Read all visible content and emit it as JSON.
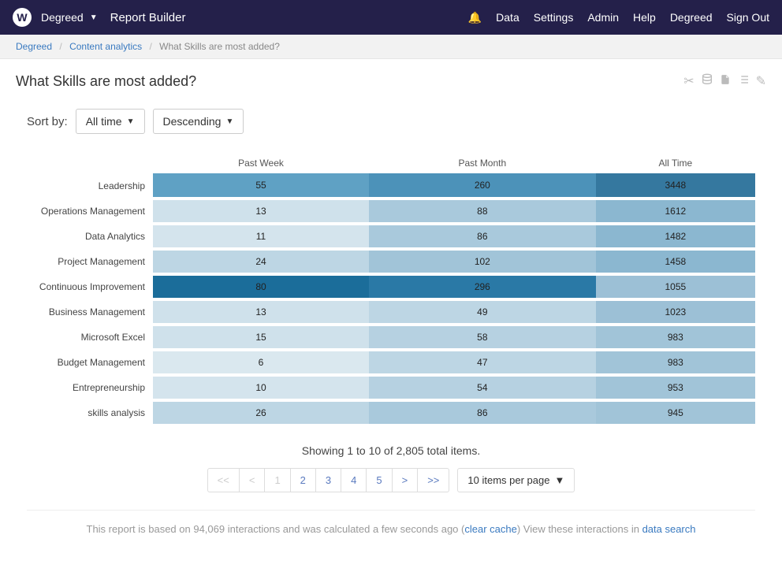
{
  "topbar": {
    "logo_letter": "W",
    "brand": "Degreed",
    "title": "Report Builder",
    "nav": {
      "data": "Data",
      "settings": "Settings",
      "admin": "Admin",
      "help": "Help",
      "degreed": "Degreed",
      "signout": "Sign Out"
    }
  },
  "breadcrumb": {
    "item1": "Degreed",
    "item2": "Content analytics",
    "item3": "What Skills are most added?"
  },
  "page_title": "What Skills are most added?",
  "sort": {
    "label": "Sort by:",
    "field": "All time",
    "direction": "Descending"
  },
  "chart_data": {
    "type": "heatmap",
    "columns": [
      "Past Week",
      "Past Month",
      "All Time"
    ],
    "rows": [
      {
        "label": "Leadership",
        "values": [
          55,
          260,
          3448
        ],
        "shades": [
          "#5fa1c4",
          "#4c92b9",
          "#35789f"
        ]
      },
      {
        "label": "Operations Management",
        "values": [
          13,
          88,
          1612
        ],
        "shades": [
          "#cfe1eb",
          "#a9c9dc",
          "#8bb7d0"
        ]
      },
      {
        "label": "Data Analytics",
        "values": [
          11,
          86,
          1482
        ],
        "shades": [
          "#d4e4ed",
          "#a9c9dc",
          "#8bb7d0"
        ]
      },
      {
        "label": "Project Management",
        "values": [
          24,
          102,
          1458
        ],
        "shades": [
          "#bdd6e4",
          "#a1c4d8",
          "#8bb7d0"
        ]
      },
      {
        "label": "Continuous Improvement",
        "values": [
          80,
          296,
          1055
        ],
        "shades": [
          "#1b6d9a",
          "#2a79a6",
          "#9cc0d6"
        ]
      },
      {
        "label": "Business Management",
        "values": [
          13,
          49,
          1023
        ],
        "shades": [
          "#cfe1eb",
          "#bdd6e4",
          "#9cc0d6"
        ]
      },
      {
        "label": "Microsoft Excel",
        "values": [
          15,
          58,
          983
        ],
        "shades": [
          "#cfe1eb",
          "#b6d1e1",
          "#a1c4d8"
        ]
      },
      {
        "label": "Budget Management",
        "values": [
          6,
          47,
          983
        ],
        "shades": [
          "#dae8ef",
          "#bdd6e4",
          "#a1c4d8"
        ]
      },
      {
        "label": "Entrepreneurship",
        "values": [
          10,
          54,
          953
        ],
        "shades": [
          "#d4e4ed",
          "#b6d1e1",
          "#a1c4d8"
        ]
      },
      {
        "label": "skills analysis",
        "values": [
          26,
          86,
          945
        ],
        "shades": [
          "#bdd6e4",
          "#a9c9dc",
          "#a1c4d8"
        ]
      }
    ]
  },
  "pagination": {
    "summary": "Showing 1 to 10 of 2,805 total items.",
    "first": "<<",
    "prev": "<",
    "p1": "1",
    "p2": "2",
    "p3": "3",
    "p4": "4",
    "p5": "5",
    "next": ">",
    "last": ">>",
    "per_page": "10 items per page"
  },
  "footer": {
    "pre": "This report is based on 94,069 interactions and was calculated a few seconds ago (",
    "clear_cache": "clear cache",
    "mid": ") View these interactions in ",
    "data_search": "data search"
  }
}
